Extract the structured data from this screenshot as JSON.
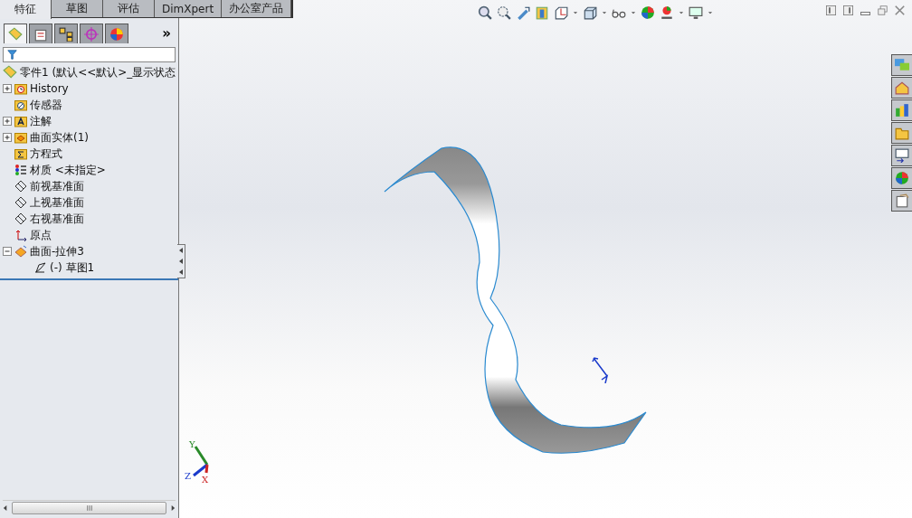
{
  "command_tabs": [
    {
      "label": "特征",
      "selected": true
    },
    {
      "label": "草图",
      "selected": false
    },
    {
      "label": "评估",
      "selected": false
    },
    {
      "label": "DimXpert",
      "selected": false
    },
    {
      "label": "办公室产品",
      "selected": false
    }
  ],
  "manager_tabs": [
    {
      "kind": "feature",
      "selected": true
    },
    {
      "kind": "property",
      "selected": false
    },
    {
      "kind": "config",
      "selected": false
    },
    {
      "kind": "dimxpert",
      "selected": false
    },
    {
      "kind": "display",
      "selected": false
    }
  ],
  "manager_more": "»",
  "tree": {
    "root": "零件1  (默认<<默认>_显示状态",
    "items": [
      {
        "kind": "history",
        "label": "History",
        "expanded": false
      },
      {
        "kind": "sensor",
        "label": "传感器"
      },
      {
        "kind": "annotation",
        "label": "注解",
        "expanded": false
      },
      {
        "kind": "bodies",
        "label": "曲面实体(1)",
        "expanded": false
      },
      {
        "kind": "equation",
        "label": "方程式"
      },
      {
        "kind": "material",
        "label": "材质 <未指定>"
      },
      {
        "kind": "plane",
        "label": "前视基准面"
      },
      {
        "kind": "plane",
        "label": "上视基准面"
      },
      {
        "kind": "plane",
        "label": "右视基准面"
      },
      {
        "kind": "origin",
        "label": "原点"
      },
      {
        "kind": "extrude",
        "label": "曲面-拉伸3",
        "expanded": true,
        "children": [
          {
            "kind": "sketch",
            "label": "(-) 草图1"
          }
        ]
      }
    ]
  },
  "triad": {
    "x": "X",
    "y": "Y",
    "z": "Z"
  }
}
